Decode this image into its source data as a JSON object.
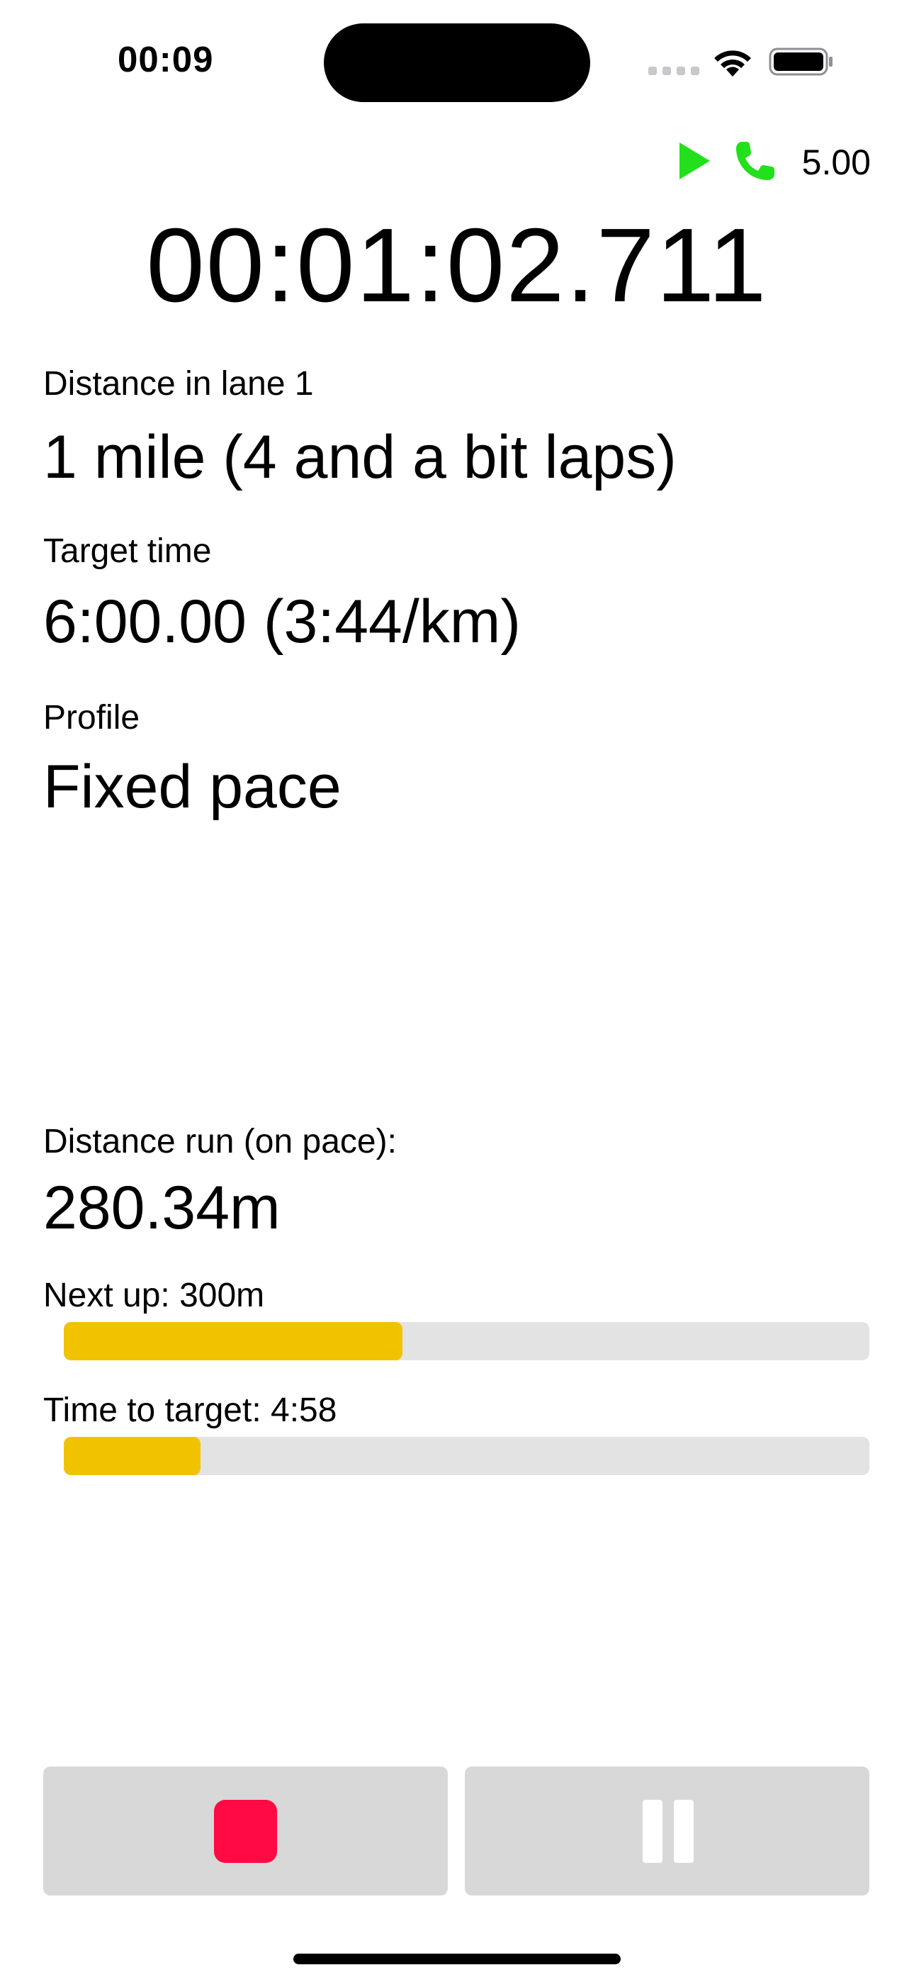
{
  "status_bar": {
    "time": "00:09",
    "icons": [
      "cellular-signal-icon",
      "wifi-icon",
      "battery-icon"
    ]
  },
  "indicators": {
    "play_icon": "play-icon",
    "phone_icon": "phone-icon",
    "speed": "5.00",
    "icon_color": "#22e01b"
  },
  "timer": "00:01:02.711",
  "distance": {
    "label": "Distance in lane 1",
    "value": "1 mile (4 and a bit laps)"
  },
  "target": {
    "label": "Target time",
    "value": "6:00.00 (3:44/km)"
  },
  "profile": {
    "label": "Profile",
    "value": "Fixed pace"
  },
  "distance_run": {
    "label": "Distance run (on pace):",
    "value": "280.34m"
  },
  "next_up": {
    "label": "Next up: 300m",
    "progress": 0.42
  },
  "time_to_target": {
    "label": "Time to target: 4:58",
    "progress": 0.17
  },
  "colors": {
    "progress_fill": "#f0c200",
    "progress_track": "#e3e3e3",
    "stop": "#ff0a45",
    "button_bg": "#d8d8d8"
  },
  "controls": {
    "stop_icon": "stop-icon",
    "pause_icon": "pause-icon"
  }
}
